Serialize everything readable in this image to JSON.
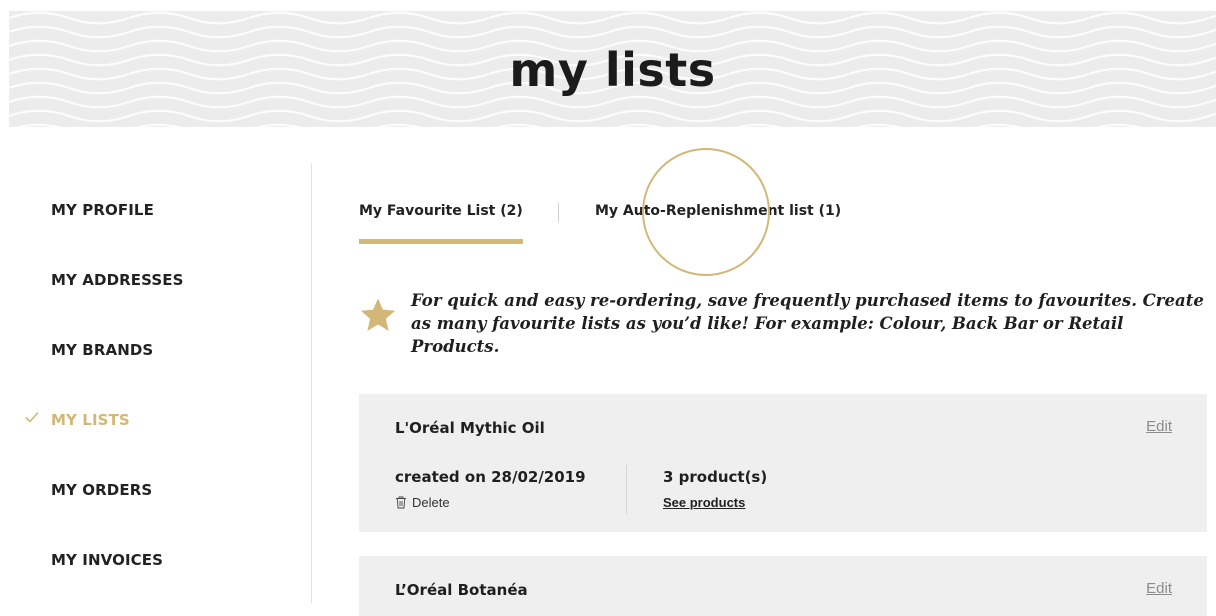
{
  "hero": {
    "title": "my lists"
  },
  "sidebar": {
    "items": [
      {
        "label": "MY PROFILE",
        "active": false
      },
      {
        "label": "MY ADDRESSES",
        "active": false
      },
      {
        "label": "MY BRANDS",
        "active": false
      },
      {
        "label": "MY LISTS",
        "active": true
      },
      {
        "label": "MY ORDERS",
        "active": false
      },
      {
        "label": "MY INVOICES",
        "active": false
      }
    ]
  },
  "tabs": [
    {
      "label": "My Favourite List (2)",
      "active": true
    },
    {
      "label": "My Auto-Replenishment list (1)",
      "active": false
    }
  ],
  "info": {
    "icon": "star-icon",
    "text": "For quick and easy re-ordering, save frequently purchased items to favourites. Create as many favourite lists as you’d like! For example: Colour, Back Bar or Retail Products."
  },
  "lists": [
    {
      "title": "L'Oréal Mythic Oil",
      "edit_label": "Edit",
      "created": "created on 28/02/2019",
      "delete_label": "Delete",
      "count": "3 product(s)",
      "see_label": "See products"
    },
    {
      "title": "L’Oréal Botanéa",
      "edit_label": "Edit"
    }
  ],
  "colors": {
    "accent": "#d3b776",
    "card_bg": "#efefef",
    "hero_bg": "#ececec"
  }
}
